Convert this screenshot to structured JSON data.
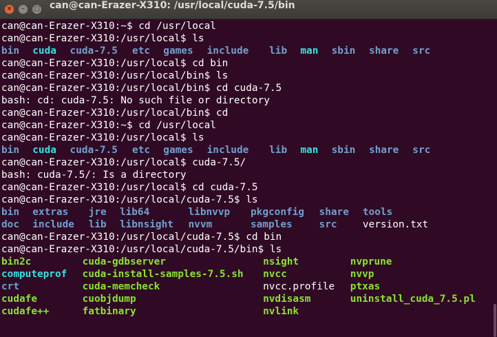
{
  "window": {
    "title": "can@can-Erazer-X310: /usr/local/cuda-7.5/bin",
    "close_glyph": "×",
    "minimize_glyph": "–",
    "maximize_glyph": "□"
  },
  "colors": {
    "background": "#300a24",
    "text": "#ffffff",
    "directory": "#729fcf",
    "link": "#34e2e2",
    "executable": "#8ae234"
  },
  "terminal": {
    "lines": [
      {
        "kind": "text",
        "text": "can@can-Erazer-X310:~$ cd /usr/local"
      },
      {
        "kind": "text",
        "text": "can@can-Erazer-X310:/usr/local$ ls"
      },
      {
        "kind": "cols",
        "items": [
          [
            "bin",
            "directory",
            0
          ],
          [
            "cuda",
            "link",
            5
          ],
          [
            "cuda-7.5",
            "directory",
            11
          ],
          [
            "etc",
            "directory",
            21
          ],
          [
            "games",
            "directory",
            26
          ],
          [
            "include",
            "directory",
            33
          ],
          [
            "lib",
            "directory",
            43
          ],
          [
            "man",
            "link",
            48
          ],
          [
            "sbin",
            "directory",
            53
          ],
          [
            "share",
            "directory",
            59
          ],
          [
            "src",
            "directory",
            66
          ]
        ]
      },
      {
        "kind": "text",
        "text": "can@can-Erazer-X310:/usr/local$ cd bin"
      },
      {
        "kind": "text",
        "text": "can@can-Erazer-X310:/usr/local/bin$ ls"
      },
      {
        "kind": "text",
        "text": "can@can-Erazer-X310:/usr/local/bin$ cd cuda-7.5"
      },
      {
        "kind": "text",
        "text": "bash: cd: cuda-7.5: No such file or directory"
      },
      {
        "kind": "text",
        "text": "can@can-Erazer-X310:/usr/local/bin$ cd"
      },
      {
        "kind": "text",
        "text": "can@can-Erazer-X310:~$ cd /usr/local"
      },
      {
        "kind": "text",
        "text": "can@can-Erazer-X310:/usr/local$ ls"
      },
      {
        "kind": "cols",
        "items": [
          [
            "bin",
            "directory",
            0
          ],
          [
            "cuda",
            "link",
            5
          ],
          [
            "cuda-7.5",
            "directory",
            11
          ],
          [
            "etc",
            "directory",
            21
          ],
          [
            "games",
            "directory",
            26
          ],
          [
            "include",
            "directory",
            33
          ],
          [
            "lib",
            "directory",
            43
          ],
          [
            "man",
            "link",
            48
          ],
          [
            "sbin",
            "directory",
            53
          ],
          [
            "share",
            "directory",
            59
          ],
          [
            "src",
            "directory",
            66
          ]
        ]
      },
      {
        "kind": "text",
        "text": "can@can-Erazer-X310:/usr/local$ cuda-7.5/"
      },
      {
        "kind": "text",
        "text": "bash: cuda-7.5/: Is a directory"
      },
      {
        "kind": "text",
        "text": "can@can-Erazer-X310:/usr/local$ cd cuda-7.5"
      },
      {
        "kind": "text",
        "text": "can@can-Erazer-X310:/usr/local/cuda-7.5$ ls"
      },
      {
        "kind": "cols",
        "items": [
          [
            "bin",
            "directory",
            0
          ],
          [
            "extras",
            "directory",
            5
          ],
          [
            "jre",
            "directory",
            14
          ],
          [
            "lib64",
            "directory",
            19
          ],
          [
            "libnvvp",
            "directory",
            30
          ],
          [
            "pkgconfig",
            "directory",
            40
          ],
          [
            "share",
            "directory",
            51
          ],
          [
            "tools",
            "directory",
            58
          ]
        ]
      },
      {
        "kind": "cols",
        "items": [
          [
            "doc",
            "directory",
            0
          ],
          [
            "include",
            "directory",
            5
          ],
          [
            "lib",
            "directory",
            14
          ],
          [
            "libnsight",
            "directory",
            19
          ],
          [
            "nvvm",
            "directory",
            30
          ],
          [
            "samples",
            "directory",
            40
          ],
          [
            "src",
            "directory",
            51
          ],
          [
            "version.txt",
            "text",
            58
          ]
        ]
      },
      {
        "kind": "text",
        "text": "can@can-Erazer-X310:/usr/local/cuda-7.5$ cd bin"
      },
      {
        "kind": "text",
        "text": "can@can-Erazer-X310:/usr/local/cuda-7.5/bin$ ls"
      },
      {
        "kind": "cols",
        "items": [
          [
            "bin2c",
            "executable",
            0
          ],
          [
            "cuda-gdbserver",
            "executable",
            13
          ],
          [
            "nsight",
            "executable",
            42
          ],
          [
            "nvprune",
            "executable",
            56
          ]
        ]
      },
      {
        "kind": "cols",
        "items": [
          [
            "computeprof",
            "link",
            0
          ],
          [
            "cuda-install-samples-7.5.sh",
            "executable",
            13
          ],
          [
            "nvcc",
            "executable",
            42
          ],
          [
            "nvvp",
            "executable",
            56
          ]
        ]
      },
      {
        "kind": "cols",
        "items": [
          [
            "crt",
            "directory",
            0
          ],
          [
            "cuda-memcheck",
            "executable",
            13
          ],
          [
            "nvcc.profile",
            "text",
            42
          ],
          [
            "ptxas",
            "executable",
            56
          ]
        ]
      },
      {
        "kind": "cols",
        "items": [
          [
            "cudafe",
            "executable",
            0
          ],
          [
            "cuobjdump",
            "executable",
            13
          ],
          [
            "nvdisasm",
            "executable",
            42
          ],
          [
            "uninstall_cuda_7.5.pl",
            "executable",
            56
          ]
        ]
      },
      {
        "kind": "cols",
        "items": [
          [
            "cudafe++",
            "executable",
            0
          ],
          [
            "fatbinary",
            "executable",
            13
          ],
          [
            "nvlink",
            "executable",
            42
          ]
        ]
      }
    ]
  }
}
